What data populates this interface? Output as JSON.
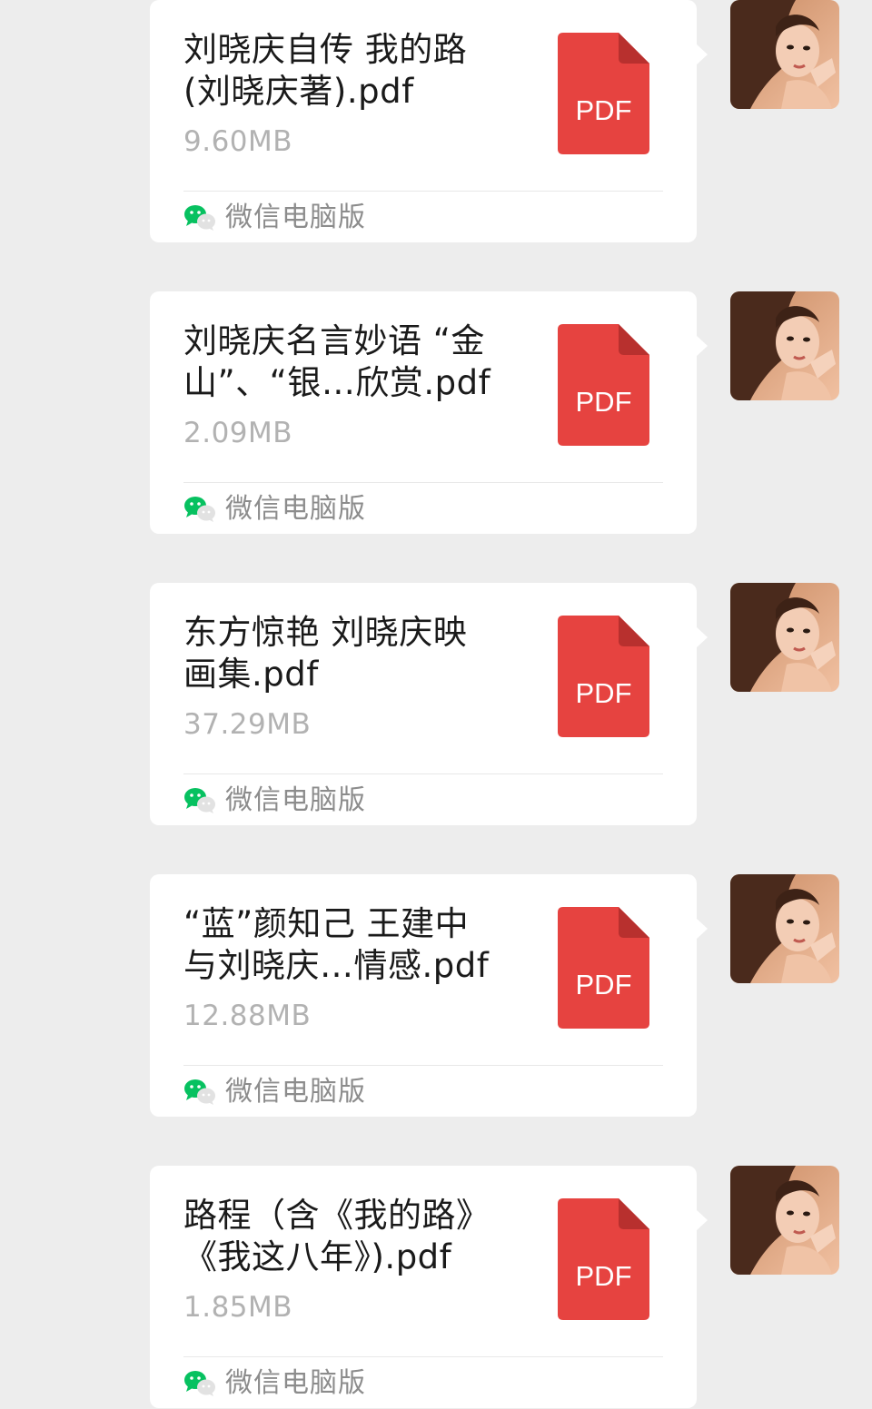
{
  "messages": [
    {
      "file_name": "刘晓庆自传 我的路\n(刘晓庆著).pdf",
      "file_size": "9.60MB",
      "file_type_label": "PDF",
      "source_label": "微信电脑版"
    },
    {
      "file_name": "刘晓庆名言妙语 “金\n山”、“银…欣赏.pdf",
      "file_size": "2.09MB",
      "file_type_label": "PDF",
      "source_label": "微信电脑版"
    },
    {
      "file_name": "东方惊艳 刘晓庆映\n画集.pdf",
      "file_size": "37.29MB",
      "file_type_label": "PDF",
      "source_label": "微信电脑版"
    },
    {
      "file_name": "“蓝”颜知己 王建中\n与刘晓庆…情感.pdf",
      "file_size": "12.88MB",
      "file_type_label": "PDF",
      "source_label": "微信电脑版"
    },
    {
      "file_name": "路程（含《我的路》\n《我这八年》).pdf",
      "file_size": "1.85MB",
      "file_type_label": "PDF",
      "source_label": "微信电脑版"
    }
  ],
  "colors": {
    "background": "#ededed",
    "bubble": "#ffffff",
    "pdf_red": "#e64340",
    "pdf_fold": "#b8302e",
    "wechat_green": "#07c160",
    "size_text": "#b2b2b2",
    "source_text": "#8c8c8c"
  },
  "icons": {
    "file_type": "pdf-file-icon",
    "source": "wechat-icon",
    "sender": "avatar"
  }
}
